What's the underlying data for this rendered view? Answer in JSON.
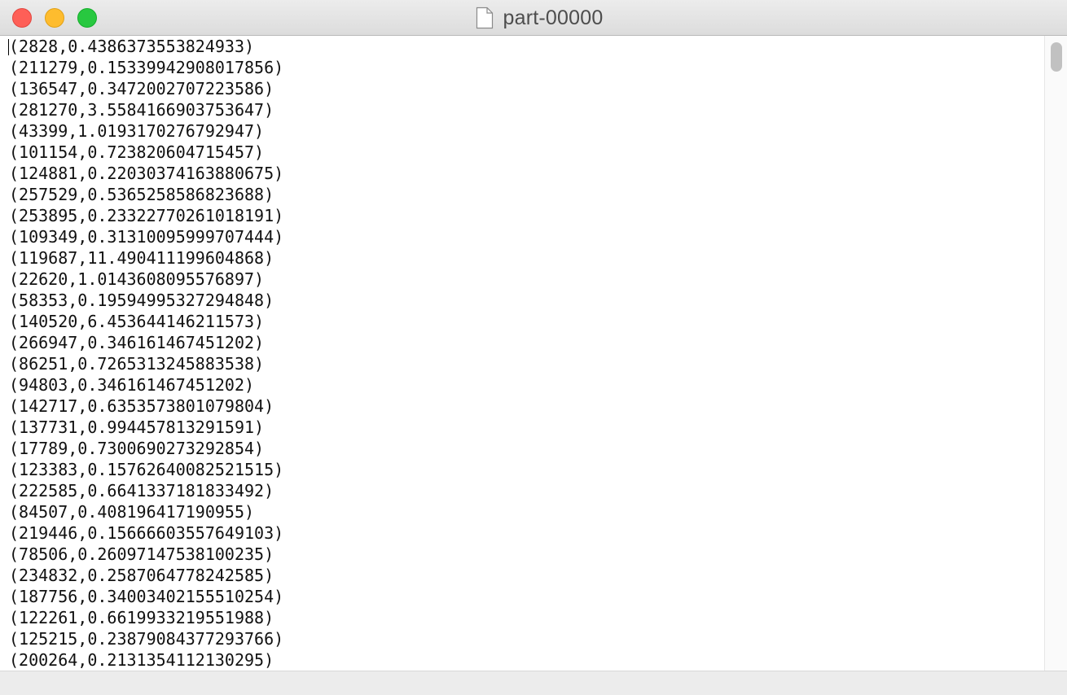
{
  "window": {
    "title": "part-00000"
  },
  "editor": {
    "lines": [
      "(2828,0.4386373553824933)",
      "(211279,0.15339942908017856)",
      "(136547,0.3472002707223586)",
      "(281270,3.5584166903753647)",
      "(43399,1.0193170276792947)",
      "(101154,0.723820604715457)",
      "(124881,0.22030374163880675)",
      "(257529,0.5365258586823688)",
      "(253895,0.23322770261018191)",
      "(109349,0.31310095999707444)",
      "(119687,11.490411199604868)",
      "(22620,1.0143608095576897)",
      "(58353,0.19594995327294848)",
      "(140520,6.453644146211573)",
      "(266947,0.346161467451202)",
      "(86251,0.7265313245883538)",
      "(94803,0.346161467451202)",
      "(142717,0.6353573801079804)",
      "(137731,0.994457813291591)",
      "(17789,0.7300690273292854)",
      "(123383,0.15762640082521515)",
      "(222585,0.6641337181833492)",
      "(84507,0.408196417190955)",
      "(219446,0.15666603557649103)",
      "(78506,0.26097147538100235)",
      "(234832,0.2587064778242585)",
      "(187756,0.34003402155510254)",
      "(122261,0.6619933219551988)",
      "(125215,0.23879084377293766)",
      "(200264,0.2131354112130295)"
    ]
  },
  "icons": {
    "close": "close-icon",
    "minimize": "minimize-icon",
    "zoom": "zoom-icon",
    "document": "document-icon"
  },
  "colors": {
    "close": "#fe5f57",
    "minimize": "#febc2e",
    "zoom": "#28c840"
  }
}
